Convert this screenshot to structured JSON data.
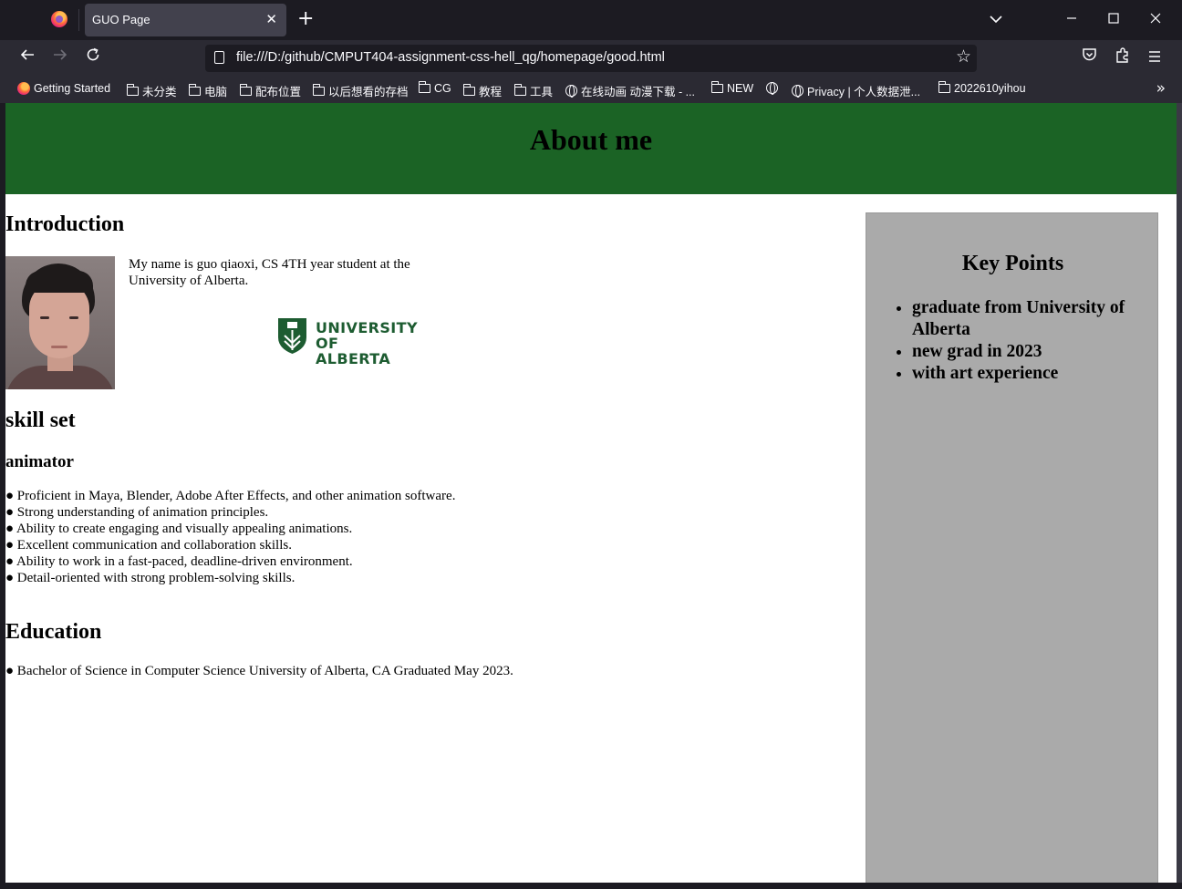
{
  "browser": {
    "tab_title": "GUO Page",
    "tab_close": "✕",
    "new_tab": "+",
    "url": "file:///D:/github/CMPUT404-assignment-css-hell_qg/homepage/good.html",
    "bookmarks": [
      "Getting Started",
      "未分类",
      "电脑",
      "配布位置",
      "以后想看的存档",
      "CG",
      "教程",
      "工具",
      "在线动画 动漫下载 - ...",
      "NEW",
      "",
      "Privacy | 个人数据泄...",
      "2022610yihou"
    ],
    "bookmark_icons": [
      "firefox-icon",
      "folder-icon",
      "folder-icon",
      "folder-icon",
      "folder-icon",
      "folder-icon",
      "folder-icon",
      "folder-icon",
      "globe-icon",
      "folder-icon",
      "globe-icon",
      "globe-icon",
      "folder-icon"
    ]
  },
  "page": {
    "header_title": "About me",
    "intro_heading": "Introduction",
    "intro_text": "My name is guo qiaoxi, CS 4TH year student at the University of Alberta.",
    "logo_text_line1": "UNIVERSITY",
    "logo_text_line2": "OF ALBERTA",
    "skill_heading": "skill set",
    "animator_heading": "animator",
    "skills": [
      "● Proficient in Maya, Blender, Adobe After Effects, and other animation software.",
      "● Strong understanding of animation principles.",
      "● Ability to create engaging and visually appealing animations.",
      "● Excellent communication and collaboration skills.",
      "● Ability to work in a fast-paced, deadline-driven environment.",
      "● Detail-oriented with strong problem-solving skills."
    ],
    "education_heading": "Education",
    "education_line": "● Bachelor of Science in Computer Science University of Alberta, CA Graduated May 2023.",
    "key_points_heading": "Key Points",
    "key_points": [
      "graduate from University of Alberta",
      "new grad in 2023",
      "with art experience"
    ]
  },
  "colors": {
    "header_green": "#1b6325",
    "aside_gray": "#aaaaaa",
    "ua_green": "#1d5c31"
  }
}
